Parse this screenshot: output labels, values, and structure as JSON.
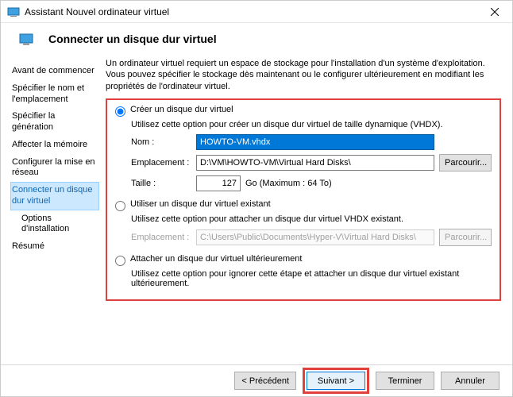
{
  "window": {
    "title": "Assistant Nouvel ordinateur virtuel",
    "close_icon": "close-icon"
  },
  "header": {
    "title": "Connecter un disque dur virtuel"
  },
  "nav": {
    "items": [
      {
        "label": "Avant de commencer"
      },
      {
        "label": "Spécifier le nom et l'emplacement"
      },
      {
        "label": "Spécifier la génération"
      },
      {
        "label": "Affecter la mémoire"
      },
      {
        "label": "Configurer la mise en réseau"
      },
      {
        "label": "Connecter un disque dur virtuel"
      },
      {
        "label": "Options d'installation"
      },
      {
        "label": "Résumé"
      }
    ],
    "selected_index": 5
  },
  "intro": "Un ordinateur virtuel requiert un espace de stockage pour l'installation d'un système d'exploitation. Vous pouvez spécifier le stockage dès maintenant ou le configurer ultérieurement en modifiant les propriétés de l'ordinateur virtuel.",
  "options": {
    "create": {
      "label": "Créer un disque dur virtuel",
      "desc": "Utilisez cette option pour créer un disque dur virtuel de taille dynamique (VHDX).",
      "name_label": "Nom :",
      "name_value": "HOWTO-VM.vhdx",
      "loc_label": "Emplacement :",
      "loc_value": "D:\\VM\\HOWTO-VM\\Virtual Hard Disks\\",
      "browse": "Parcourir...",
      "size_label": "Taille :",
      "size_value": "127",
      "size_suffix": "Go (Maximum : 64 To)"
    },
    "use": {
      "label": "Utiliser un disque dur virtuel existant",
      "desc": "Utilisez cette option pour attacher un disque dur virtuel VHDX existant.",
      "loc_label": "Emplacement :",
      "loc_value": "C:\\Users\\Public\\Documents\\Hyper-V\\Virtual Hard Disks\\",
      "browse": "Parcourir..."
    },
    "later": {
      "label": "Attacher un disque dur virtuel ultérieurement",
      "desc": "Utilisez cette option pour ignorer cette étape et attacher un disque dur virtuel existant ultérieurement."
    },
    "selected": "create"
  },
  "footer": {
    "prev": "< Précédent",
    "next": "Suivant >",
    "finish": "Terminer",
    "cancel": "Annuler"
  }
}
